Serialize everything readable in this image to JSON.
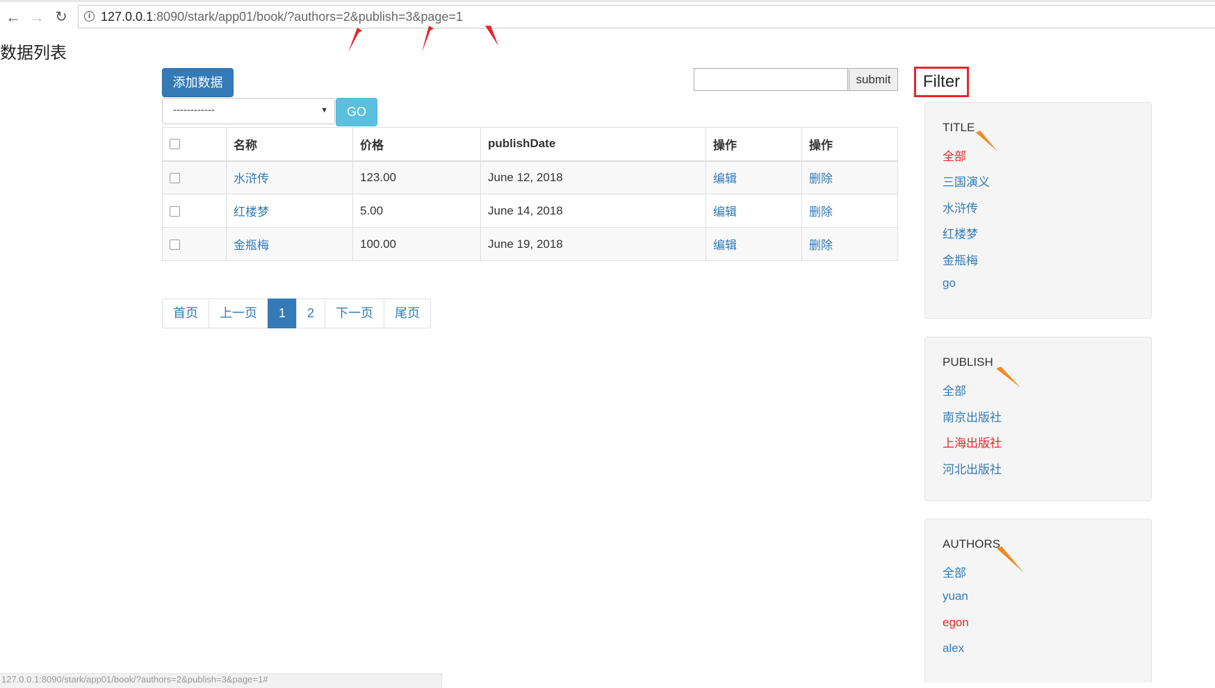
{
  "browser": {
    "url_host": "127.0.0.1",
    "url_rest": ":8090/stark/app01/book/?authors=2&publish=3&page=1",
    "back_icon": "←",
    "forward_icon": "→",
    "reload_icon": "↻",
    "info_icon": "i"
  },
  "page": {
    "title": "数据列表"
  },
  "toolbar": {
    "add_label": "添加数据",
    "action_select_value": "------------",
    "go_label": "GO",
    "search_value": "",
    "submit_label": "submit"
  },
  "table": {
    "headers": [
      "名称",
      "价格",
      "publishDate",
      "操作",
      "操作"
    ],
    "rows": [
      {
        "name": "水浒传",
        "price": "123.00",
        "date": "June 12, 2018",
        "edit": "编辑",
        "delete": "删除"
      },
      {
        "name": "红楼梦",
        "price": "5.00",
        "date": "June 14, 2018",
        "edit": "编辑",
        "delete": "删除"
      },
      {
        "name": "金瓶梅",
        "price": "100.00",
        "date": "June 19, 2018",
        "edit": "编辑",
        "delete": "删除"
      }
    ]
  },
  "pagination": {
    "first": "首页",
    "prev": "上一页",
    "pages": [
      "1",
      "2"
    ],
    "active_page": "1",
    "next": "下一页",
    "last": "尾页"
  },
  "filter": {
    "label": "Filter",
    "groups": [
      {
        "title": "TITLE",
        "options": [
          "全部",
          "三国演义",
          "水浒传",
          "红楼梦",
          "金瓶梅",
          "go"
        ],
        "active": "全部"
      },
      {
        "title": "PUBLISH",
        "options": [
          "全部",
          "南京出版社",
          "上海出版社",
          "河北出版社"
        ],
        "active": "上海出版社"
      },
      {
        "title": "AUTHORS",
        "options": [
          "全部",
          "yuan",
          "egon",
          "alex"
        ],
        "active": "egon"
      }
    ]
  },
  "status_bar": {
    "text": "127.0.0.1:8090/stark/app01/book/?authors=2&publish=3&page=1#"
  },
  "colors": {
    "primary": "#337ab7",
    "info": "#5bc0de",
    "active_filter": "#e8252a",
    "annotation_red": "#e8252a",
    "annotation_orange": "#f08a24"
  }
}
